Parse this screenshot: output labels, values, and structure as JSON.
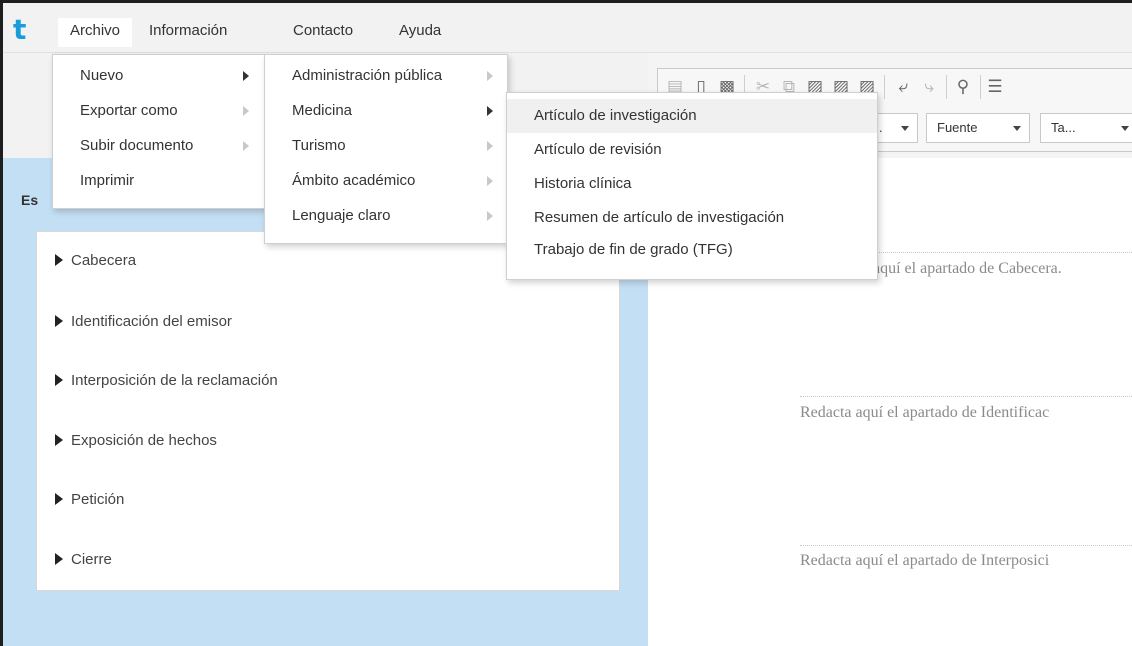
{
  "menubar": {
    "logo": "t",
    "items": [
      "Archivo",
      "Información",
      "Contacto",
      "Ayuda"
    ]
  },
  "archivo_menu": {
    "items": [
      {
        "label": "Nuevo",
        "has_submenu": true,
        "active": true
      },
      {
        "label": "Exportar como",
        "has_submenu": true,
        "active": false
      },
      {
        "label": "Subir documento",
        "has_submenu": true,
        "active": false
      },
      {
        "label": "Imprimir",
        "has_submenu": false,
        "active": false
      }
    ]
  },
  "nuevo_submenu": {
    "items": [
      {
        "label": "Administración pública",
        "active": false
      },
      {
        "label": "Medicina",
        "active": true
      },
      {
        "label": "Turismo",
        "active": false
      },
      {
        "label": "Ámbito académico",
        "active": false
      },
      {
        "label": "Lenguaje claro",
        "active": false
      }
    ]
  },
  "medicina_submenu": {
    "items": [
      "Artículo de investigación",
      "Artículo de revisión",
      "Historia clínica",
      "Resumen de artículo de investigación",
      "Trabajo de fin de grado (TFG)"
    ],
    "highlighted_index": 0
  },
  "left_panel": {
    "title_visible": "Es",
    "outline_items": [
      "Cabecera",
      "Identificación del emisor",
      "Interposición de la reclamación",
      "Exposición de hechos",
      "Petición",
      "Cierre"
    ]
  },
  "toolbar": {
    "font_select": "Fuente",
    "size_select": "Ta...",
    "style_select": "."
  },
  "document": {
    "sections": [
      "aquí el apartado de Cabecera.",
      "Redacta aquí el apartado de Identificac",
      "Redacta aquí el apartado de Interposici"
    ]
  },
  "colors": {
    "accent": "#1a9bdc",
    "panel_bg": "#c3dff4",
    "menubar_bg": "#f2f2f2"
  }
}
